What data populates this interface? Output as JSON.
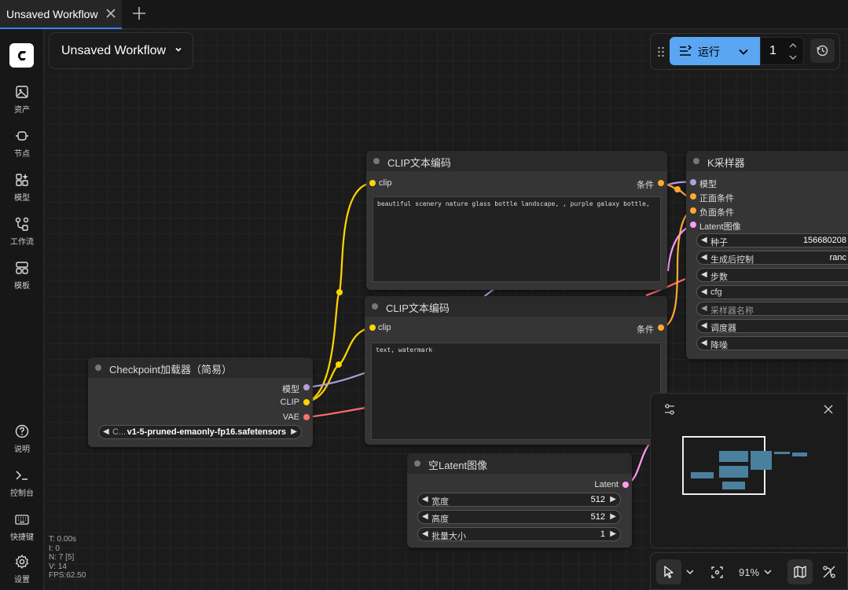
{
  "tabs": [
    {
      "title": "Unsaved Workflow"
    }
  ],
  "sidebar": {
    "items": [
      {
        "label": "资产",
        "icon": "image-icon"
      },
      {
        "label": "节点",
        "icon": "node-icon"
      },
      {
        "label": "模型",
        "icon": "model-icon"
      },
      {
        "label": "工作流",
        "icon": "workflow-icon"
      },
      {
        "label": "模板",
        "icon": "template-icon"
      },
      {
        "label": "说明",
        "icon": "help-icon"
      },
      {
        "label": "控制台",
        "icon": "terminal-icon"
      },
      {
        "label": "快捷键",
        "icon": "keyboard-icon"
      },
      {
        "label": "设置",
        "icon": "settings-icon"
      }
    ]
  },
  "workflow": {
    "title": "Unsaved Workflow"
  },
  "run": {
    "label": "运行",
    "count": "1"
  },
  "nodes": {
    "clip1": {
      "title": "CLIP文本编码",
      "input": "clip",
      "output": "条件",
      "text": "beautiful scenery nature glass bottle landscape, , purple galaxy bottle,"
    },
    "clip2": {
      "title": "CLIP文本编码",
      "input": "clip",
      "output": "条件",
      "text": "text, watermark"
    },
    "ksampler": {
      "title": "K采样器",
      "inputs": [
        "模型",
        "正面条件",
        "负面条件",
        "Latent图像"
      ],
      "widgets": [
        {
          "label": "种子",
          "value": "156680208"
        },
        {
          "label": "生成后控制",
          "value": "ranc"
        },
        {
          "label": "步数",
          "value": ""
        },
        {
          "label": "cfg",
          "value": ""
        },
        {
          "label": "采样器名称",
          "value": ""
        },
        {
          "label": "调度器",
          "value": ""
        },
        {
          "label": "降噪",
          "value": ""
        }
      ]
    },
    "checkpoint": {
      "title": "Checkpoint加载器（简易）",
      "outputs": [
        "模型",
        "CLIP",
        "VAE"
      ],
      "widget_label": "C...",
      "widget_value": "v1-5-pruned-emaonly-fp16.safetensors"
    },
    "latent": {
      "title": "空Latent图像",
      "output": "Latent",
      "widgets": [
        {
          "label": "宽度",
          "value": "512"
        },
        {
          "label": "高度",
          "value": "512"
        },
        {
          "label": "批量大小",
          "value": "1"
        }
      ]
    }
  },
  "stats": {
    "time": "T: 0.00s",
    "i": "I: 0",
    "n": "N: 7 [5]",
    "v": "V: 14",
    "fps": "FPS:62.50"
  },
  "bottombar": {
    "zoom": "91%"
  },
  "colors": {
    "accent": "#5aa6f2",
    "clip": "#ffd500",
    "model": "#b39ddb",
    "vae": "#ff6e6e",
    "conditioning": "#ffa931",
    "latent": "#ff9cf9"
  }
}
